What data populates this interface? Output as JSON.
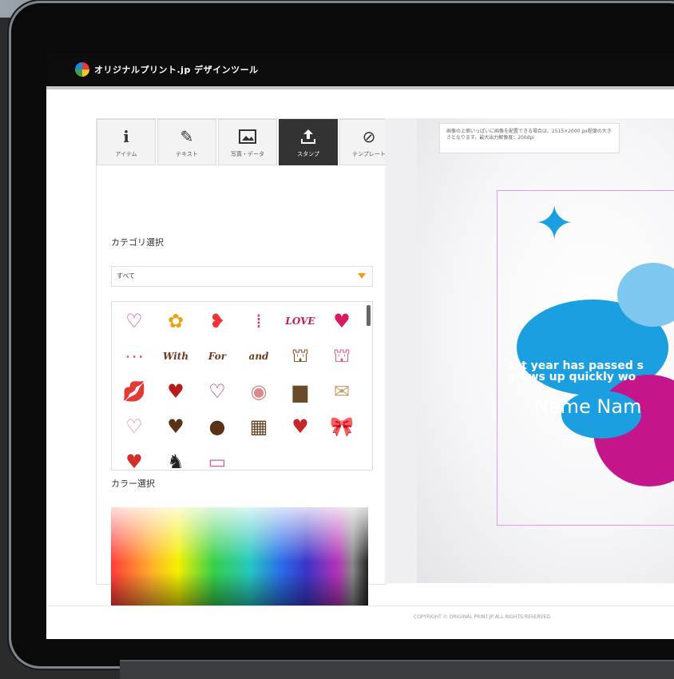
{
  "app": {
    "title": "オリジナルプリント.jp デザインツール"
  },
  "tabs": [
    {
      "label": "アイテム",
      "icon": "info-icon"
    },
    {
      "label": "テキスト",
      "icon": "pencil-icon"
    },
    {
      "label": "写真・データ",
      "icon": "image-icon"
    },
    {
      "label": "スタンプ",
      "icon": "upload-icon"
    },
    {
      "label": "テンプレート",
      "icon": "template-icon"
    }
  ],
  "active_tab": "スタンプ",
  "category": {
    "label": "カテゴリ選択",
    "selected": "すべて"
  },
  "color": {
    "label": "カラー選択"
  },
  "notice": {
    "text": "画像の上側いっぱいに画像を配置できる場合は、2515×2000 px程度の大きさとなります。最大出力解像度：200dpi"
  },
  "design": {
    "line1": "1st year has passed s",
    "line2": "grows up quickly wo",
    "name": "Name Nam"
  },
  "footer": {
    "copyright": "COPYRIGHT © ORIGINAL PRINT.JP ALL RIGHTS RESERVED."
  },
  "stamps": [
    {
      "name": "heart-outline-stamp",
      "glyph": "♡",
      "color": "#e0307a"
    },
    {
      "name": "hearts-cluster-stamp",
      "glyph": "✿",
      "color": "#e8a317"
    },
    {
      "name": "small-hearts-stamp",
      "glyph": "❥",
      "color": "#e33"
    },
    {
      "name": "candles-stamp",
      "glyph": "⁞",
      "color": "#d8406a"
    },
    {
      "name": "love-banner-stamp",
      "glyph": "LOVE",
      "color": "#c2185b"
    },
    {
      "name": "hearts-line-stamp",
      "glyph": "♥",
      "color": "#d81b60"
    },
    {
      "name": "dotted-line-stamp",
      "glyph": "⋯",
      "color": "#e06a8f"
    },
    {
      "name": "with-text-stamp",
      "glyph": "With",
      "color": "#6d3b1f"
    },
    {
      "name": "for-text-stamp",
      "glyph": "For",
      "color": "#6d3b1f"
    },
    {
      "name": "and-text-stamp",
      "glyph": "and",
      "color": "#6d3b1f"
    },
    {
      "name": "cupcake-brown-stamp",
      "glyph": "⛫",
      "color": "#8d4a1c"
    },
    {
      "name": "cupcake-pink-stamp",
      "glyph": "⛫",
      "color": "#e05a8a"
    },
    {
      "name": "lips-stamp",
      "glyph": "💋",
      "color": "#d32f2f"
    },
    {
      "name": "winged-heart-stamp",
      "glyph": "♥",
      "color": "#b71c1c"
    },
    {
      "name": "double-heart-stamp",
      "glyph": "♡",
      "color": "#c2185b"
    },
    {
      "name": "heart-badge-stamp",
      "glyph": "◉",
      "color": "#d88"
    },
    {
      "name": "chocolate-box-stamp",
      "glyph": "▆",
      "color": "#6b4a2b"
    },
    {
      "name": "envelope-stamp",
      "glyph": "✉",
      "color": "#c8a06a"
    },
    {
      "name": "pink-heart-outline-stamp",
      "glyph": "♡",
      "color": "#e07aa0"
    },
    {
      "name": "chocolate-heart-stamp",
      "glyph": "♥",
      "color": "#5a3215"
    },
    {
      "name": "chocolate-round-stamp",
      "glyph": "●",
      "color": "#5a3215"
    },
    {
      "name": "chocolate-bar-stamp",
      "glyph": "▦",
      "color": "#6b4325"
    },
    {
      "name": "red-heart-stamp",
      "glyph": "♥",
      "color": "#c62828"
    },
    {
      "name": "ribbon-stamp",
      "glyph": "🎀",
      "color": "#d32f2f"
    },
    {
      "name": "heart-bottom-1-stamp",
      "glyph": "♥",
      "color": "#d32f2f"
    },
    {
      "name": "cupid-stamp",
      "glyph": "♞",
      "color": "#222"
    },
    {
      "name": "pink-banner-stamp",
      "glyph": "▭",
      "color": "#e05a8a"
    }
  ]
}
